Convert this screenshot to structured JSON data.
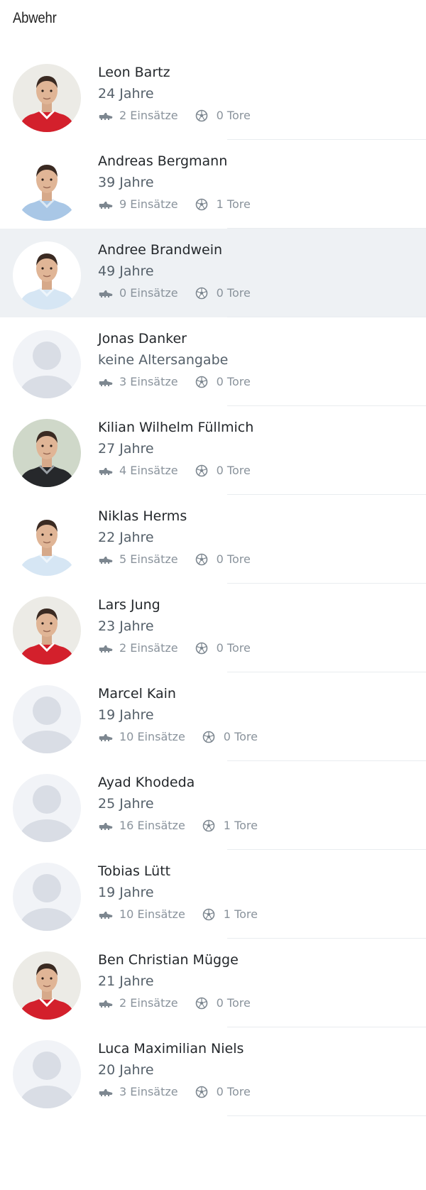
{
  "section": {
    "title": "Abwehr"
  },
  "players": [
    {
      "name": "Leon Bartz",
      "age": "24 Jahre",
      "appearances": "2 Einsätze",
      "goals": "0 Tore",
      "avatar": "red-kit"
    },
    {
      "name": "Andreas Bergmann",
      "age": "39 Jahre",
      "appearances": "9 Einsätze",
      "goals": "1 Tore",
      "avatar": "blue-kit"
    },
    {
      "name": "Andree Brandwein",
      "age": "49 Jahre",
      "appearances": "0 Einsätze",
      "goals": "0 Tore",
      "avatar": "light-kit",
      "highlighted": true
    },
    {
      "name": "Jonas Danker",
      "age": "keine Altersangabe",
      "appearances": "3 Einsätze",
      "goals": "0 Tore",
      "avatar": "placeholder"
    },
    {
      "name": "Kilian Wilhelm Füllmich",
      "age": "27 Jahre",
      "appearances": "4 Einsätze",
      "goals": "0 Tore",
      "avatar": "black-kit"
    },
    {
      "name": "Niklas Herms",
      "age": "22 Jahre",
      "appearances": "5 Einsätze",
      "goals": "0 Tore",
      "avatar": "light-kit"
    },
    {
      "name": "Lars Jung",
      "age": "23 Jahre",
      "appearances": "2 Einsätze",
      "goals": "0 Tore",
      "avatar": "red-kit"
    },
    {
      "name": "Marcel Kain",
      "age": "19 Jahre",
      "appearances": "10 Einsätze",
      "goals": "0 Tore",
      "avatar": "placeholder"
    },
    {
      "name": "Ayad Khodeda",
      "age": "25 Jahre",
      "appearances": "16 Einsätze",
      "goals": "1 Tore",
      "avatar": "placeholder"
    },
    {
      "name": "Tobias Lütt",
      "age": "19 Jahre",
      "appearances": "10 Einsätze",
      "goals": "1 Tore",
      "avatar": "placeholder"
    },
    {
      "name": "Ben Christian Mügge",
      "age": "21 Jahre",
      "appearances": "2 Einsätze",
      "goals": "0 Tore",
      "avatar": "red-kit"
    },
    {
      "name": "Luca Maximilian Niels",
      "age": "20 Jahre",
      "appearances": "3 Einsätze",
      "goals": "0 Tore",
      "avatar": "placeholder"
    }
  ],
  "icons": {
    "appearances": "football-boot-icon",
    "goals": "football-icon"
  },
  "colors": {
    "highlight": "#eef1f4",
    "divider": "#e9ecef",
    "meta": "#8a939c",
    "kit_red": "#d3202c"
  }
}
